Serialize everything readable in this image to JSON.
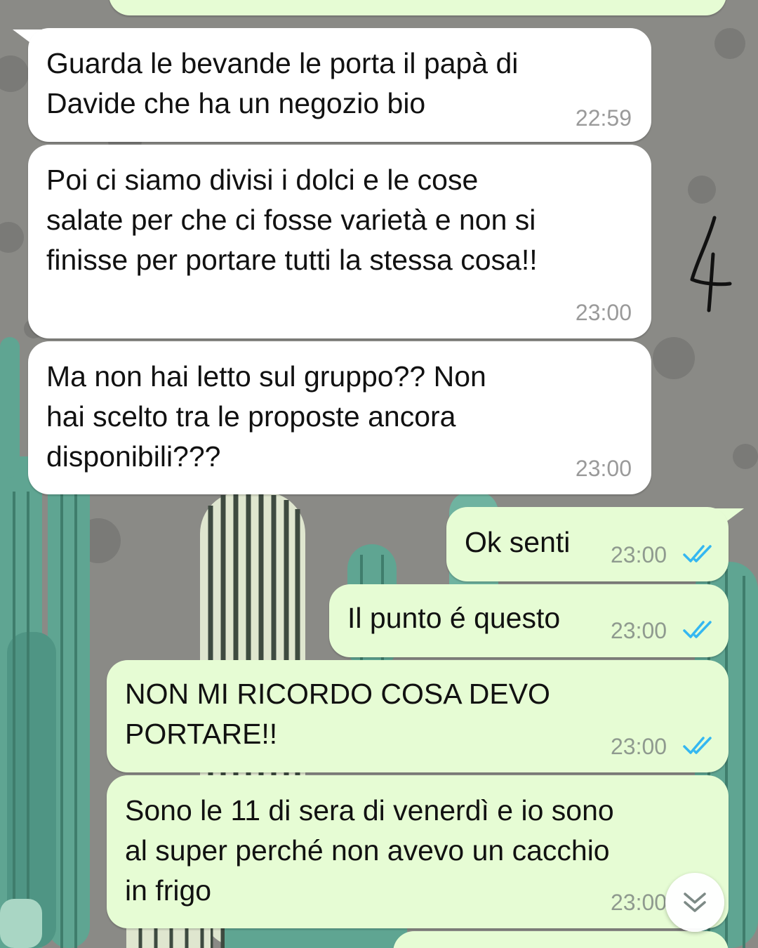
{
  "chat": {
    "messages": [
      {
        "direction": "incoming",
        "text": "Guarda le bevande le porta il papà di\nDavide che ha un negozio bio",
        "time": "22:59"
      },
      {
        "direction": "incoming",
        "text": "Poi ci siamo divisi i dolci e le cose\nsalate per che ci fosse varietà e non si\nfinisse per portare tutti la stessa cosa!!",
        "time": "23:00"
      },
      {
        "direction": "incoming",
        "text": "Ma non hai letto sul gruppo?? Non\nhai scelto tra le proposte ancora\ndisponibili???",
        "time": "23:00"
      },
      {
        "direction": "outgoing",
        "text": "Ok senti",
        "time": "23:00",
        "status": "read"
      },
      {
        "direction": "outgoing",
        "text": "Il punto é questo",
        "time": "23:00",
        "status": "read"
      },
      {
        "direction": "outgoing",
        "text": "NON MI RICORDO COSA DEVO\nPORTARE!!",
        "time": "23:00",
        "status": "read"
      },
      {
        "direction": "outgoing",
        "text": "Sono le 11 di sera di venerdì e io sono\nal super perché non avevo un cacchio\nin frigo",
        "time": "23:00",
        "status": "read"
      }
    ],
    "doodle_text": "4",
    "scroll_button_icon": "double-chevron-down-icon"
  },
  "colors": {
    "incoming_bubble": "#ffffff",
    "outgoing_bubble": "#e6fcd4",
    "read_ticks": "#34b7f1",
    "wallpaper": "#8a8a86",
    "cactus": "#5fa592"
  }
}
